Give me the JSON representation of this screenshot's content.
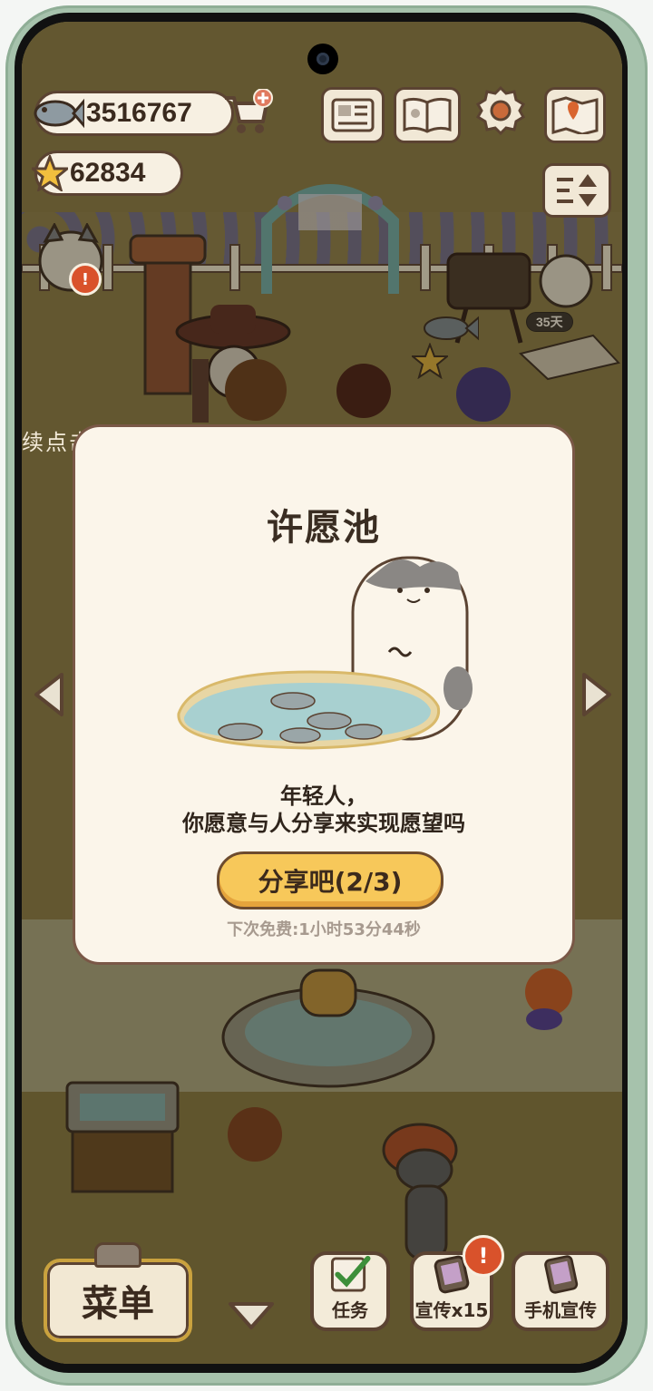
{
  "hud": {
    "fish_count": "3516767",
    "star_count": "62834",
    "day_label": "35天"
  },
  "scroll_text": "续点击宣传按钮就可以招揽更多的顾客",
  "modal": {
    "title": "许愿池",
    "message_line1": "年轻人，",
    "message_line2": "你愿意与人分享来实现愿望吗",
    "share_button": "分享吧(2/3)",
    "timer": "下次免费:1小时53分44秒"
  },
  "bottom_bar": {
    "menu_label": "菜单",
    "task_label": "任务",
    "promo_label": "宣传x15",
    "phone_promo_label": "手机宣传"
  },
  "colors": {
    "ground": "#897943",
    "modal_bg": "#fbf5ea",
    "button_yellow": "#f7c85a",
    "badge_red": "#d9522b"
  }
}
